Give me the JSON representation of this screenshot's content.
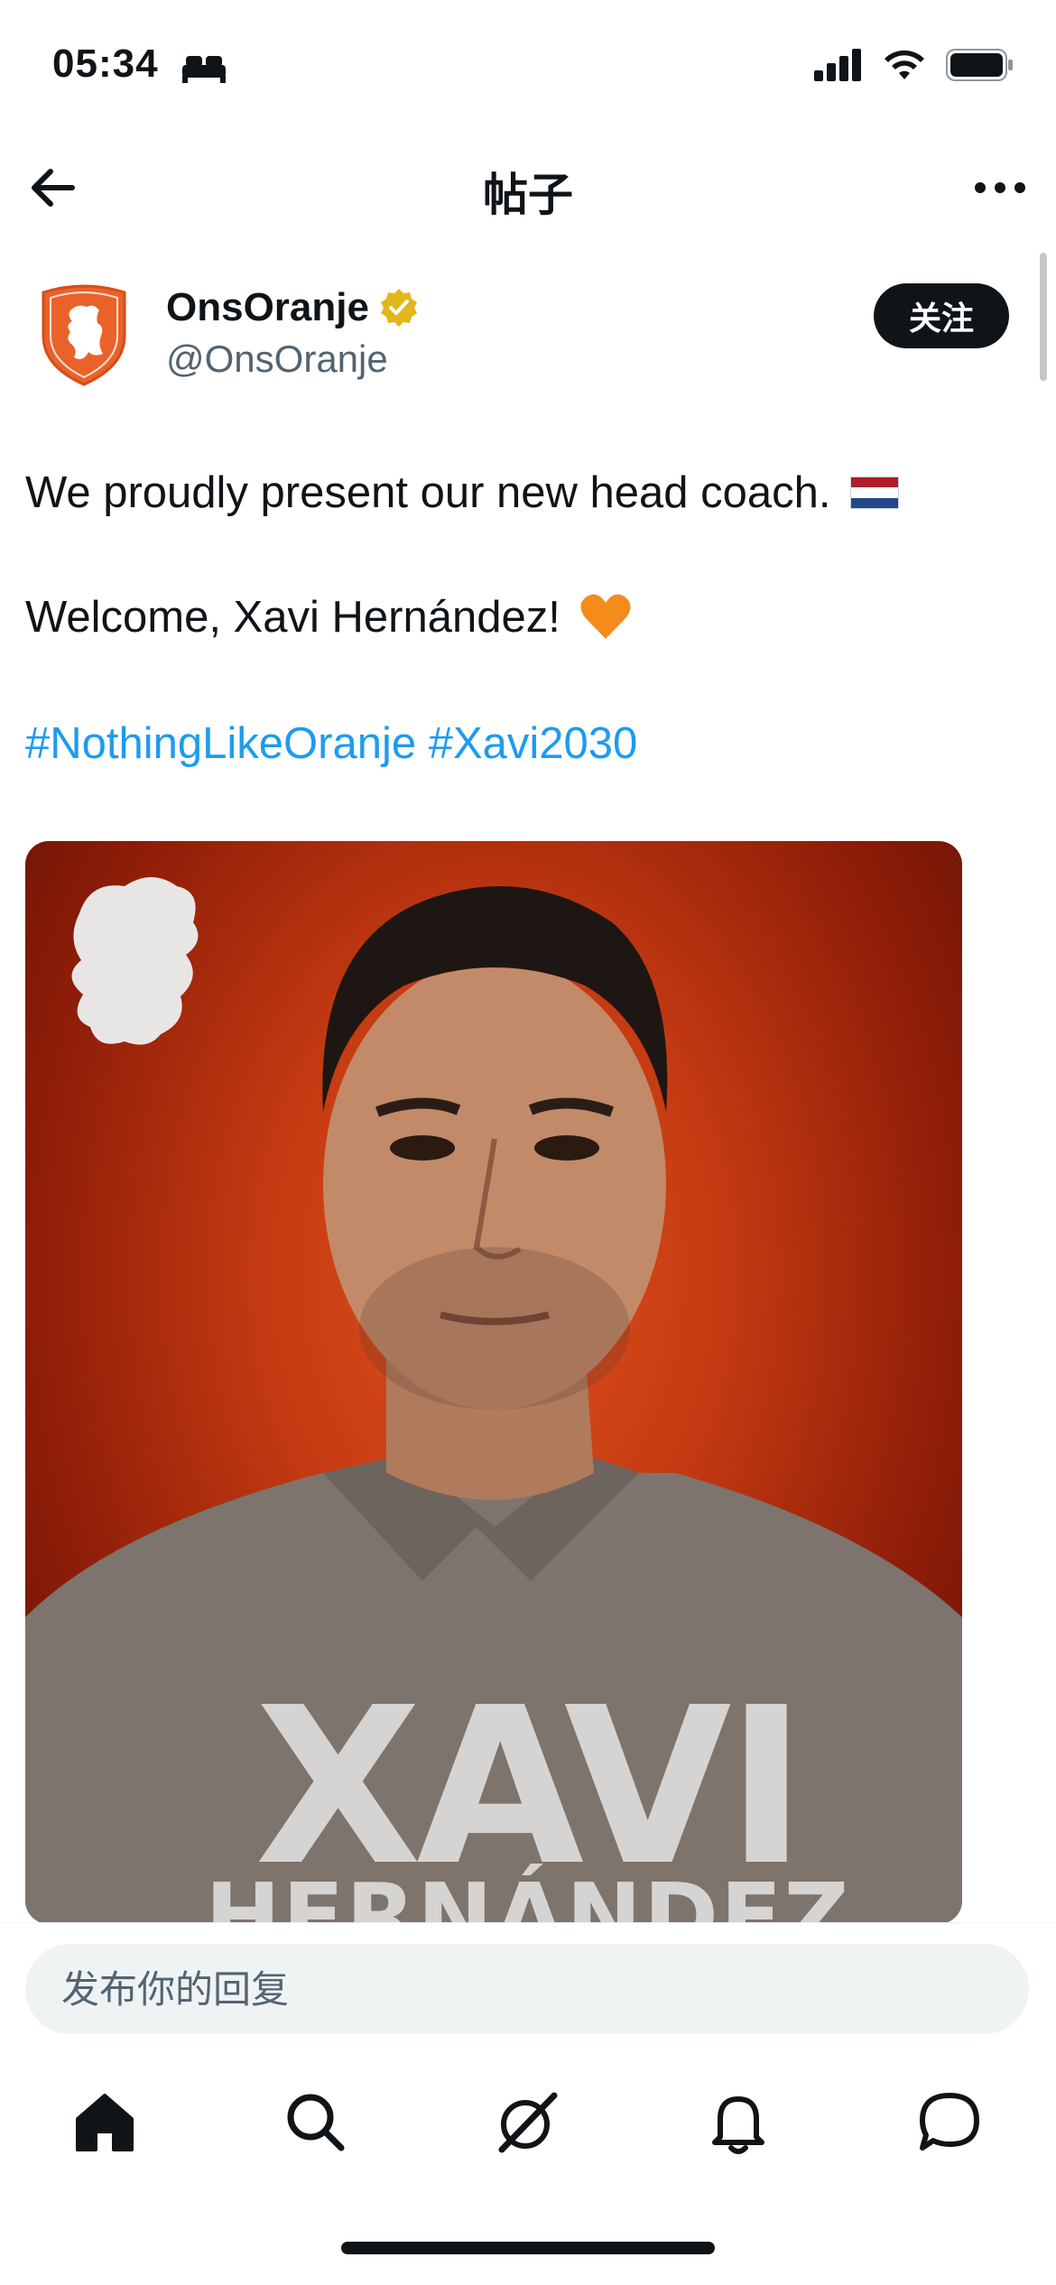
{
  "status_bar": {
    "time": "05:34"
  },
  "header": {
    "title": "帖子"
  },
  "post": {
    "author": {
      "display_name": "OnsOranje",
      "handle": "@OnsOranje"
    },
    "follow_label": "关注",
    "lines": {
      "line1": "We proudly present our new head coach.",
      "line2": "Welcome, Xavi Hernández!",
      "hashtag1": "#NothingLikeOranje",
      "hashtag2": "#Xavi2030"
    },
    "media": {
      "name_line1": "XAVI",
      "name_line2": "HERNÁNDEZ"
    }
  },
  "reply": {
    "placeholder": "发布你的回复"
  },
  "nav": {
    "items": [
      "home-icon",
      "search-icon",
      "grok-icon",
      "notifications-icon",
      "messages-icon"
    ]
  },
  "colors": {
    "link": "#1d9bf0",
    "orange": "#e9622a",
    "verified_gold": "#e2b719"
  }
}
